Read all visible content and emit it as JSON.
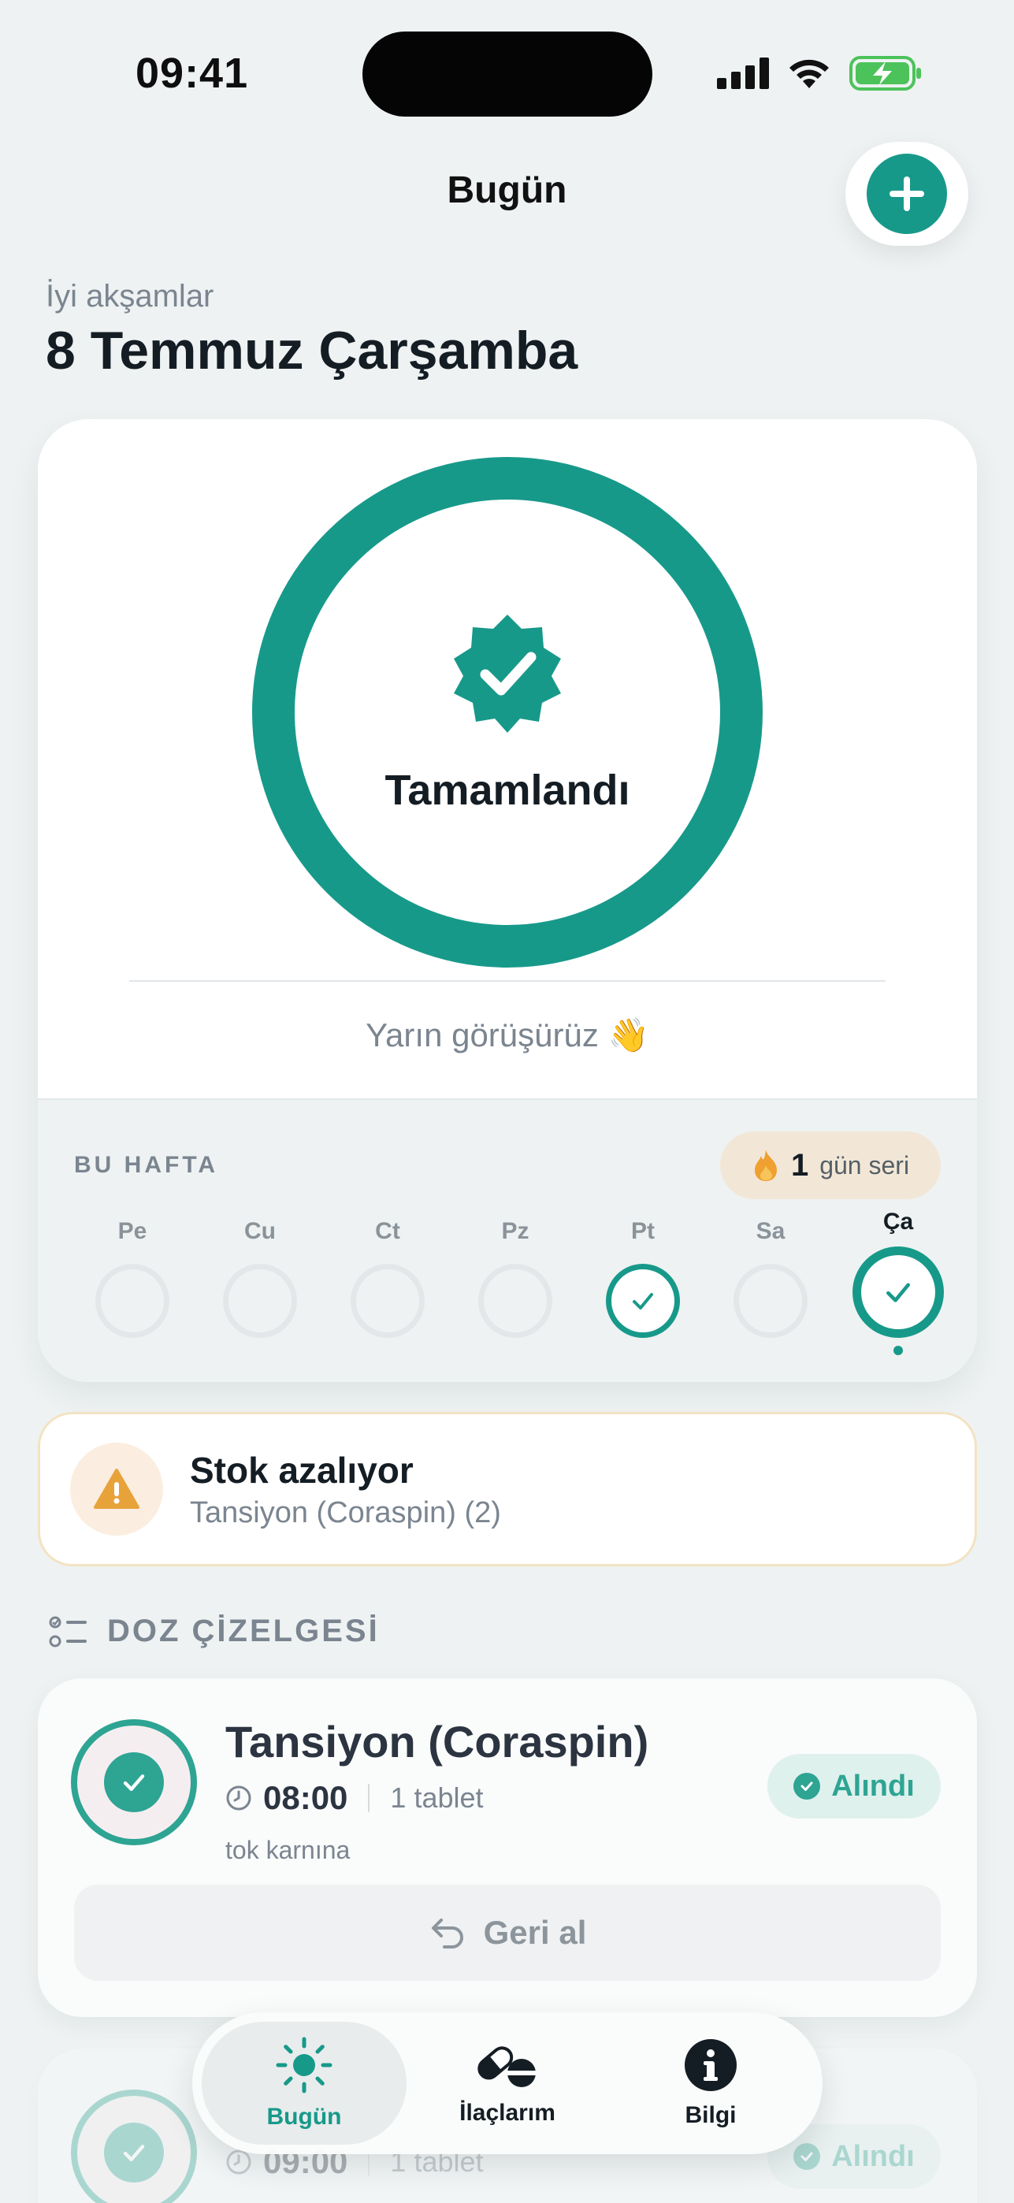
{
  "status_bar": {
    "time": "09:41"
  },
  "header": {
    "title": "Bugün"
  },
  "greeting": "İyi akşamlar",
  "date": "8 Temmuz Çarşamba",
  "progress_card": {
    "status_label": "Tamamlandı",
    "progress": 1.0,
    "footer_text": "Yarın görüşürüz 👋",
    "week": {
      "title": "BU HAFTA",
      "streak_count": "1",
      "streak_label": "gün seri",
      "days": [
        {
          "label": "Pe",
          "done": false
        },
        {
          "label": "Cu",
          "done": false
        },
        {
          "label": "Ct",
          "done": false
        },
        {
          "label": "Pz",
          "done": false
        },
        {
          "label": "Pt",
          "done": true
        },
        {
          "label": "Sa",
          "done": false
        },
        {
          "label": "Ça",
          "done": true,
          "today": true
        }
      ]
    }
  },
  "stock_alert": {
    "title": "Stok azalıyor",
    "subtitle": "Tansiyon (Coraspin) (2)"
  },
  "schedule": {
    "title": "DOZ ÇİZELGESİ",
    "doses": [
      {
        "name": "Tansiyon (Coraspin)",
        "time": "08:00",
        "amount": "1 tablet",
        "note": "tok karnına",
        "status": "Alındı",
        "undo_label": "Geri al"
      },
      {
        "name": "",
        "time": "09:00",
        "amount": "1 tablet",
        "note": "",
        "status": "Alındı"
      }
    ]
  },
  "tabbar": {
    "tabs": [
      {
        "label": "Bugün",
        "icon": "sun-icon",
        "active": true
      },
      {
        "label": "İlaçlarım",
        "icon": "pills-icon",
        "active": false
      },
      {
        "label": "Bilgi",
        "icon": "info-icon",
        "active": false
      }
    ]
  },
  "colors": {
    "accent": "#17998a",
    "warning": "#e8a23a",
    "background": "#eef2f2"
  }
}
